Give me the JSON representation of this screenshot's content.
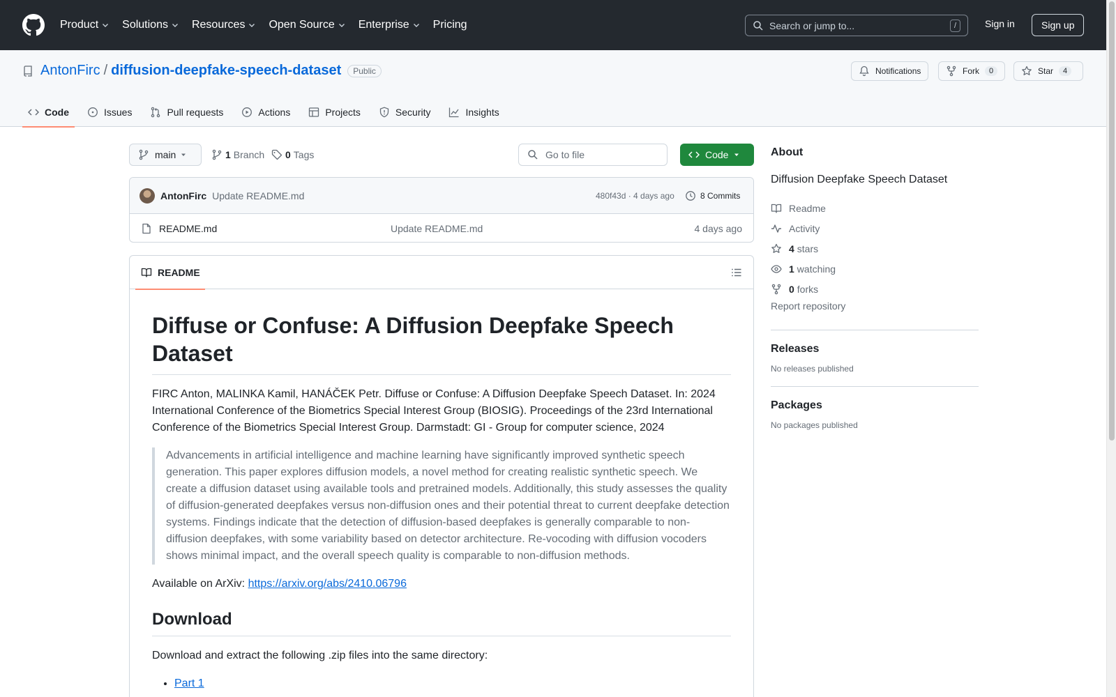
{
  "header": {
    "nav": [
      {
        "label": "Product",
        "dropdown": true
      },
      {
        "label": "Solutions",
        "dropdown": true
      },
      {
        "label": "Resources",
        "dropdown": true
      },
      {
        "label": "Open Source",
        "dropdown": true
      },
      {
        "label": "Enterprise",
        "dropdown": true
      },
      {
        "label": "Pricing",
        "dropdown": false
      }
    ],
    "search_placeholder": "Search or jump to...",
    "search_shortcut": "/",
    "signin": "Sign in",
    "signup": "Sign up"
  },
  "repo": {
    "owner": "AntonFirc",
    "separator": "/",
    "name": "diffusion-deepfake-speech-dataset",
    "visibility": "Public",
    "notifications_label": "Notifications",
    "fork_label": "Fork",
    "fork_count": "0",
    "star_label": "Star",
    "star_count": "4",
    "tabs": [
      {
        "label": "Code",
        "icon": "code-icon",
        "active": true
      },
      {
        "label": "Issues",
        "icon": "issue-icon",
        "active": false
      },
      {
        "label": "Pull requests",
        "icon": "pull-request-icon",
        "active": false
      },
      {
        "label": "Actions",
        "icon": "play-icon",
        "active": false
      },
      {
        "label": "Projects",
        "icon": "table-icon",
        "active": false
      },
      {
        "label": "Security",
        "icon": "shield-icon",
        "active": false
      },
      {
        "label": "Insights",
        "icon": "graph-icon",
        "active": false
      }
    ]
  },
  "toolbar": {
    "branch": "main",
    "branch_count": "1",
    "branch_label": "Branch",
    "tag_count": "0",
    "tag_label": "Tags",
    "goto_placeholder": "Go to file",
    "code_button": "Code"
  },
  "commit": {
    "author": "AntonFirc",
    "message": "Update README.md",
    "hash_info": "480f43d · 4 days ago",
    "commits_label": "8 Commits"
  },
  "files": [
    {
      "name": "README.md",
      "message": "Update README.md",
      "date": "4 days ago"
    }
  ],
  "readme": {
    "tab_label": "README",
    "title": "Diffuse or Confuse: A Diffusion Deepfake Speech Dataset",
    "citation": "FIRC Anton, MALINKA Kamil, HANÁČEK Petr. Diffuse or Confuse: A Diffusion Deepfake Speech Dataset. In: 2024 International Conference of the Biometrics Special Interest Group (BIOSIG). Proceedings of the 23rd International Conference of the Biometrics Special Interest Group. Darmstadt: GI - Group for computer science, 2024",
    "abstract": "Advancements in artificial intelligence and machine learning have significantly improved synthetic speech generation. This paper explores diffusion models, a novel method for creating realistic synthetic speech. We create a diffusion dataset using available tools and pretrained models. Additionally, this study assesses the quality of diffusion-generated deepfakes versus non-diffusion ones and their potential threat to current deepfake detection systems. Findings indicate that the detection of diffusion-based deepfakes is generally comparable to non-diffusion deepfakes, with some variability based on detector architecture. Re-vocoding with diffusion vocoders shows minimal impact, and the overall speech quality is comparable to non-diffusion methods.",
    "arxiv_prefix": "Available on ArXiv: ",
    "arxiv_link": "https://arxiv.org/abs/2410.06796",
    "download_heading": "Download",
    "download_text": "Download and extract the following .zip files into the same directory:",
    "download_items": [
      "Part 1"
    ]
  },
  "about": {
    "heading": "About",
    "description": "Diffusion Deepfake Speech Dataset",
    "readme": "Readme",
    "activity": "Activity",
    "stars_count": "4",
    "stars_label": "stars",
    "watching_count": "1",
    "watching_label": "watching",
    "forks_count": "0",
    "forks_label": "forks",
    "report": "Report repository"
  },
  "releases": {
    "heading": "Releases",
    "text": "No releases published"
  },
  "packages": {
    "heading": "Packages",
    "text": "No packages published"
  },
  "colors": {
    "header_bg": "#24292f",
    "link": "#0969da",
    "primary_button": "#1f883d",
    "active_tab": "#fd8c73"
  }
}
